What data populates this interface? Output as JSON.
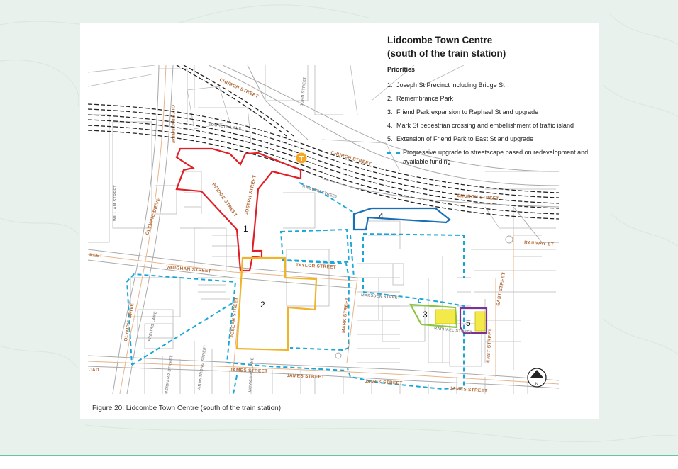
{
  "figure": {
    "title_line1": "Lidcombe Town Centre",
    "title_line2": "(south of the train station)",
    "priorities_heading": "Priorities",
    "priorities": [
      {
        "num": "1.",
        "text": "Joseph St Precinct including Bridge St"
      },
      {
        "num": "2.",
        "text": "Remembrance Park"
      },
      {
        "num": "3.",
        "text": "Friend Park expansion to Raphael St and upgrade"
      },
      {
        "num": "4.",
        "text": "Mark St pedestrian crossing and embellishment of traffic island"
      },
      {
        "num": "5.",
        "text": "Extension of Friend Park to East St and upgrade"
      }
    ],
    "dashed_legend": "Progressive upgrade to streetscape based on redevelopment and available funding",
    "caption": "Figure 20: Lidcombe Town Centre (south of the train station)"
  },
  "map": {
    "streets": {
      "church_1": "CHURCH STREET",
      "church_2": "CHURCH STREET",
      "church_3": "CHURCH STREET",
      "john": "JOHN STREET",
      "olympic_1": "OLYMPIC DRIVE",
      "olympic_2": "OLYMPIC DRIVE",
      "olympic_3": "OLYMPIC DRIVE",
      "toohets": "TOOHETS LANE",
      "bridge": "BRIDGE STREET",
      "joseph_1": "JOSEPH STREET",
      "joseph_2": "JOSEPH STREET",
      "railway_1": "RAILWAY STREET",
      "railway_2": "RAILWAY ST",
      "railway_3": "REET",
      "william": "WILLIAM STREET",
      "vaughan": "VAUGHAN STREET",
      "taylor": "TAYLOR STREET",
      "marsden": "MARSDEN STREET",
      "raphael": "RAPHAEL STREET",
      "mark": "MARK STREET",
      "east_1": "EAST STREET",
      "east_2": "EAST STREET",
      "james_1": "JAMES STREET",
      "james_2": "JAMES STREET",
      "james_3": "JAMES STREET",
      "james_4": "JAMES STREET",
      "freitas": "FREITAS LANE",
      "bernard": "BERNARD STREET",
      "armstrong": "ARMSTRONG STREET",
      "mcvicars": "MCVICARS LANE",
      "road_stub": "JAD"
    },
    "areas": [
      {
        "label": "1",
        "color": "#e02026",
        "name": "Joseph St Precinct including Bridge St"
      },
      {
        "label": "2",
        "color": "#f0b428",
        "name": "Remembrance Park"
      },
      {
        "label": "3",
        "color": "#8cc63f",
        "name": "Friend Park expansion"
      },
      {
        "label": "4",
        "color": "#1a6eb5",
        "name": "Mark St pedestrian crossing"
      },
      {
        "label": "5",
        "color": "#7b3294",
        "name": "Extension of Friend Park"
      }
    ],
    "station_icon": "T",
    "north_arrow_label": "N"
  }
}
